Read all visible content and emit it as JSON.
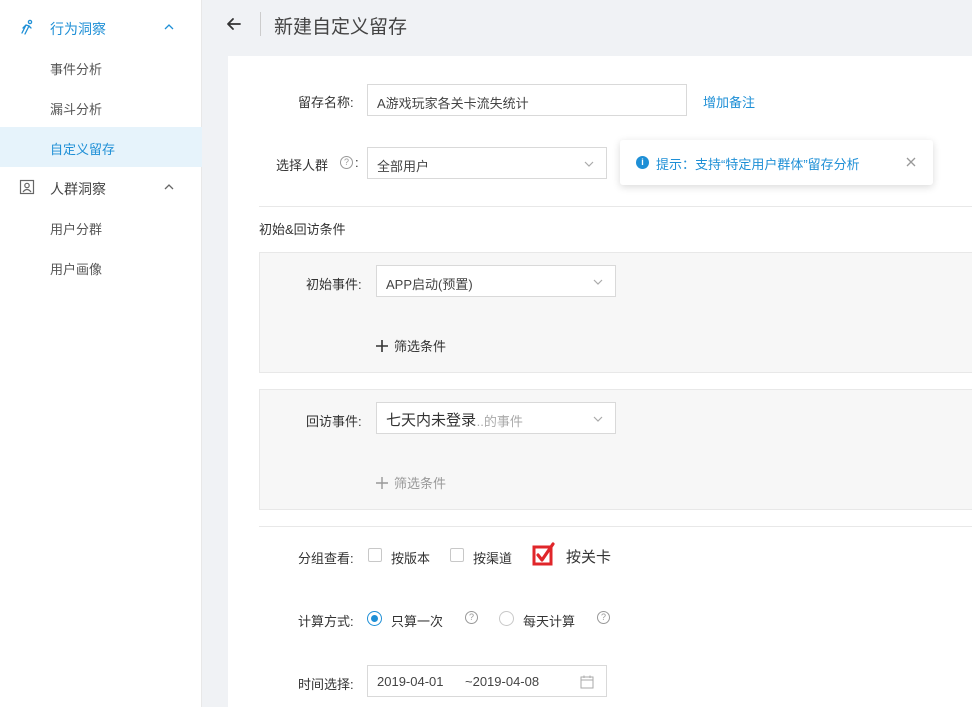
{
  "sidebar": {
    "group_behavior": "行为洞察",
    "group_people": "人群洞察",
    "items_behavior": [
      "事件分析",
      "漏斗分析",
      "自定义留存"
    ],
    "items_people": [
      "用户分群",
      "用户画像"
    ]
  },
  "header": {
    "title": "新建自定义留存"
  },
  "form": {
    "name_label": "留存名称:",
    "name_value": "A游戏玩家各关卡流失统计",
    "add_note": "增加备注",
    "crowd_label": "选择人群",
    "crowd_colon": ":",
    "crowd_value": "全部用户",
    "tip_text": "提示：支持“特定用户群体”留存分析",
    "section_title": "初始&回访条件",
    "init_label": "初始事件:",
    "init_value": "APP启动(预置)",
    "filter_label": "筛选条件",
    "return_label": "回访事件:",
    "return_value": "七天内未登录",
    "return_placeholder": "...的事件",
    "filter_label2": "筛选条件",
    "group_label": "分组查看:",
    "group_options": [
      "按版本",
      "按渠道",
      "按关卡"
    ],
    "calc_label": "计算方式:",
    "calc_options": [
      "只算一次",
      "每天计算"
    ],
    "time_label": "时间选择:",
    "date_start": "2019-04-01",
    "date_end": "~2019-04-08"
  },
  "colors": {
    "accent": "#1e8fd6",
    "check_red": "#e0262a"
  }
}
